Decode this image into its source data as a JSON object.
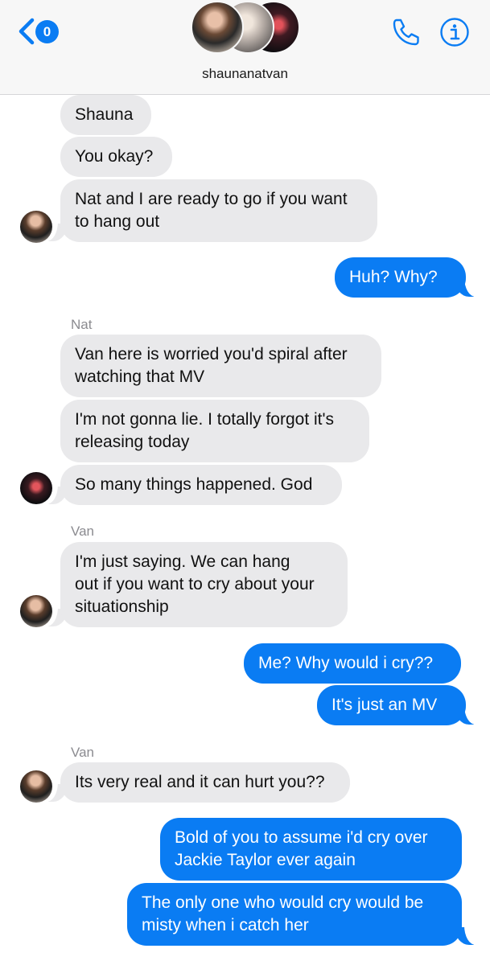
{
  "header": {
    "back_badge_count": "0",
    "conversation_name": "shaunanatvan",
    "icons": [
      "back-chevron-icon",
      "phone-icon",
      "info-icon"
    ]
  },
  "messages": [
    {
      "direction": "incoming",
      "sender": "",
      "text": "Shauna"
    },
    {
      "direction": "incoming",
      "sender": "",
      "text": "You okay?"
    },
    {
      "direction": "incoming",
      "sender": "",
      "lines": [
        "Nat and I are ready to go if you want",
        "to hang out"
      ]
    },
    {
      "direction": "outgoing",
      "text": "Huh? Why?"
    },
    {
      "direction": "incoming",
      "sender": "Nat",
      "lines": [
        "Van here is worried you'd spiral after",
        "watching that MV"
      ]
    },
    {
      "direction": "incoming",
      "sender": "",
      "lines": [
        "I'm not gonna lie. I totally forgot it's",
        "releasing today"
      ]
    },
    {
      "direction": "incoming",
      "sender": "",
      "text": "So many things happened. God"
    },
    {
      "direction": "incoming",
      "sender": "Van",
      "lines": [
        "I'm just saying. We can hang",
        "out if you want to cry about your",
        "situationship"
      ]
    },
    {
      "direction": "outgoing",
      "text": "Me? Why would i cry??"
    },
    {
      "direction": "outgoing",
      "text": "It's just an MV"
    },
    {
      "direction": "incoming",
      "sender": "Van",
      "text": "Its very real and it can hurt you??"
    },
    {
      "direction": "outgoing",
      "lines": [
        "Bold of you to assume i'd cry over",
        "Jackie Taylor ever again"
      ]
    },
    {
      "direction": "outgoing",
      "lines": [
        "The only one who would cry would be",
        "misty when i catch her"
      ]
    }
  ],
  "colors": {
    "accent": "#0a7cf3",
    "incoming_bubble": "#e9e9eb",
    "header_bg": "#f7f7f7",
    "sender_label": "#8b8b90"
  }
}
